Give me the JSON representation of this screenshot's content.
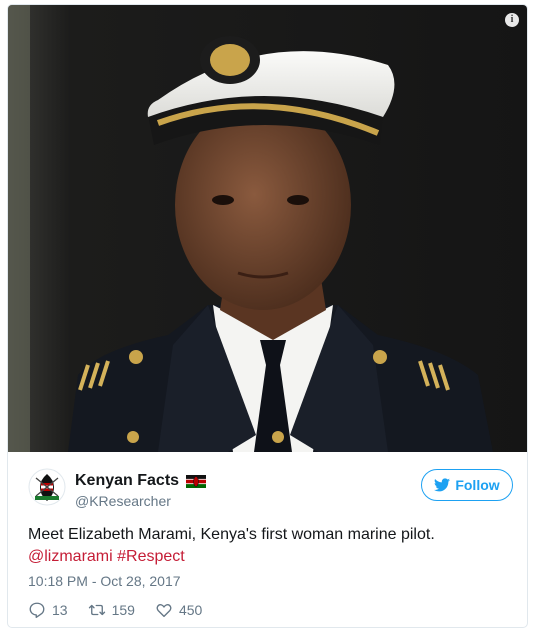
{
  "tweet": {
    "display_name": "Kenyan Facts",
    "handle": "@KResearcher",
    "follow_label": "Follow",
    "text_plain": "Meet Elizabeth Marami, Kenya's first woman marine pilot.",
    "mention": "@lizmarami",
    "hashtag": "#Respect",
    "timestamp": "10:18 PM - Oct 28, 2017",
    "info_glyph": "i",
    "stats": {
      "replies": "13",
      "retweets": "159",
      "likes": "450"
    }
  },
  "icons": {
    "info": "info-icon",
    "flag": "kenya-flag-icon",
    "follow": "twitter-bird-icon",
    "reply": "reply-icon",
    "retweet": "retweet-icon",
    "like": "heart-icon"
  },
  "colors": {
    "accent": "#1da1f2",
    "link": "#c51d36",
    "muted": "#657786",
    "text": "#14171a"
  }
}
